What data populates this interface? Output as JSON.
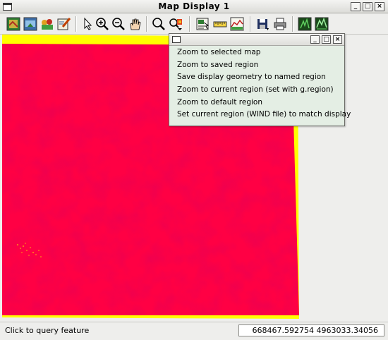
{
  "window": {
    "title": "Map Display 1",
    "controls": {
      "minimize": "_",
      "maximize": "□",
      "close": "×"
    }
  },
  "toolbar": {
    "tools": [
      {
        "name": "display-map-icon"
      },
      {
        "name": "redraw-display-icon"
      },
      {
        "name": "add-layer-icon"
      },
      {
        "name": "draw-icon"
      },
      {
        "name": "pointer-icon"
      },
      {
        "name": "zoom-in-icon"
      },
      {
        "name": "zoom-out-icon"
      },
      {
        "name": "pan-icon"
      },
      {
        "name": "zoom-back-icon"
      },
      {
        "name": "zoom-menu-icon"
      },
      {
        "name": "query-icon"
      },
      {
        "name": "measure-icon"
      },
      {
        "name": "profile-icon"
      },
      {
        "name": "save-icon"
      },
      {
        "name": "print-icon"
      },
      {
        "name": "2d-view-icon"
      },
      {
        "name": "3d-view-icon"
      }
    ]
  },
  "zoom_menu": {
    "controls": {
      "minimize": "_",
      "maximize": "□",
      "close": "×"
    },
    "items": [
      "Zoom to selected map",
      "Zoom to saved region",
      "Save display geometry to named region",
      "Zoom to current region (set with g.region)",
      "Zoom to default region",
      "Set current region (WIND file) to match display"
    ]
  },
  "map": {
    "raster_color": "#ff0044",
    "border_color": "#ffff00",
    "background": "#eeeeec"
  },
  "status": {
    "message": "Click to query feature",
    "coordinates": "668467.592754 4963033.34056"
  }
}
